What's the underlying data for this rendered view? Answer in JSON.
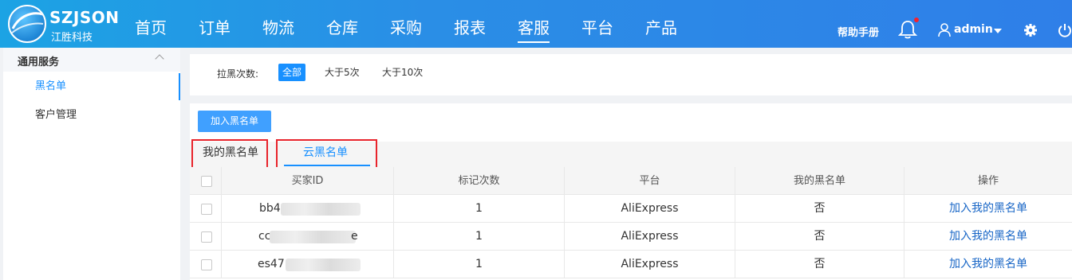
{
  "header": {
    "brand": "SZJSON",
    "brand_sub": "江胜科技",
    "nav": [
      "首页",
      "订单",
      "物流",
      "仓库",
      "采购",
      "报表",
      "客服",
      "平台",
      "产品"
    ],
    "active_nav": "客服",
    "help": "帮助手册",
    "user": "admin",
    "icons": [
      "bell-icon",
      "user-icon",
      "caret-down-icon",
      "gear-icon",
      "power-icon"
    ],
    "colors": {
      "header_start": "#1ca3e4",
      "header_end": "#2f7fe8",
      "notification_dot": "#f5222d"
    }
  },
  "sidebar": {
    "group": "通用服务",
    "items": [
      "黑名单",
      "客户管理"
    ],
    "active": "黑名单"
  },
  "filter": {
    "label": "拉黑次数:",
    "options": [
      "全部",
      "大于5次",
      "大于10次"
    ],
    "selected": "全部"
  },
  "main": {
    "add_button": "加入黑名单",
    "tabs": [
      "我的黑名单",
      "云黑名单"
    ],
    "active_tab": "云黑名单",
    "table": {
      "headers": [
        "买家ID",
        "标记次数",
        "平台",
        "我的黑名单",
        "操作"
      ],
      "rows": [
        {
          "id_prefix": "bb4",
          "id_suffix": "",
          "count": "1",
          "platform": "AliExpress",
          "in_my_list": "否",
          "action": "加入我的黑名单"
        },
        {
          "id_prefix": "cc",
          "id_suffix": "e",
          "count": "1",
          "platform": "AliExpress",
          "in_my_list": "否",
          "action": "加入我的黑名单"
        },
        {
          "id_prefix": "es47",
          "id_suffix": "",
          "count": "1",
          "platform": "AliExpress",
          "in_my_list": "否",
          "action": "加入我的黑名单"
        }
      ]
    },
    "colors": {
      "accent": "#1890ff",
      "highlight_box": "#e8232b",
      "link": "#1765c6"
    }
  }
}
